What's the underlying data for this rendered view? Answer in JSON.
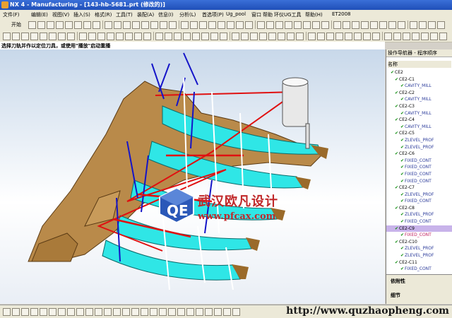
{
  "window": {
    "title": "NX 4 - Manufacturing - [143-hb-5681.prt (修改的)]"
  },
  "menu": [
    "文件(F)",
    "编辑(E)",
    "视图(V)",
    "插入(S)",
    "格式(R)",
    "工具(T)",
    "装配(A)",
    "信息(I)",
    "分析(L)",
    "首选项(P)",
    "Ug_pool",
    "窗口",
    "帮助",
    "环仪UG工具",
    "帮助(H)",
    "ET2008"
  ],
  "toolbar": {
    "start_label": "开始"
  },
  "cue_line": "选择刀轨并作以定位刀具，或使用\"播放\"启动重播",
  "navigator": {
    "title": "操作导航器 - 程序顺序",
    "column_name": "名称",
    "items": [
      {
        "label": "CE2",
        "kind": "group"
      },
      {
        "label": "CE2-C1",
        "kind": "group"
      },
      {
        "label": "CAVITY_MILL",
        "kind": "op"
      },
      {
        "label": "CE2-C2",
        "kind": "group"
      },
      {
        "label": "CAVITY_MILL",
        "kind": "op"
      },
      {
        "label": "CE2-C3",
        "kind": "group"
      },
      {
        "label": "CAVITY_MILL",
        "kind": "op"
      },
      {
        "label": "CE2-C4",
        "kind": "group"
      },
      {
        "label": "CAVITY_MILL",
        "kind": "op"
      },
      {
        "label": "CE2-C5",
        "kind": "group"
      },
      {
        "label": "ZLEVEL_PROF",
        "kind": "op"
      },
      {
        "label": "ZLEVEL_PROF",
        "kind": "op"
      },
      {
        "label": "CE2-C6",
        "kind": "group"
      },
      {
        "label": "FIXED_CONT",
        "kind": "op"
      },
      {
        "label": "FIXED_CONT",
        "kind": "op"
      },
      {
        "label": "FIXED_CONT",
        "kind": "op"
      },
      {
        "label": "FIXED_CONT",
        "kind": "op"
      },
      {
        "label": "CE2-C7",
        "kind": "group"
      },
      {
        "label": "ZLEVEL_PROF",
        "kind": "op"
      },
      {
        "label": "FIXED_CONT",
        "kind": "op"
      },
      {
        "label": "CE2-C8",
        "kind": "group"
      },
      {
        "label": "ZLEVEL_PROF",
        "kind": "op"
      },
      {
        "label": "FIXED_CONT",
        "kind": "op"
      },
      {
        "label": "CE2-C9",
        "kind": "group",
        "selected": true
      },
      {
        "label": "FIXED_CONT",
        "kind": "op",
        "pink": true
      },
      {
        "label": "CE2-C10",
        "kind": "group"
      },
      {
        "label": "ZLEVEL_PROF",
        "kind": "op"
      },
      {
        "label": "ZLEVEL_PROF",
        "kind": "op"
      },
      {
        "label": "CE2-C11",
        "kind": "group"
      },
      {
        "label": "FIXED_CONT",
        "kind": "op"
      }
    ],
    "dependency_title": "依附性",
    "details_title": "细节"
  },
  "watermark": {
    "logo_text": "QE",
    "cn": "武汉欧凡设计",
    "url": "www.pfcax.com"
  },
  "bottom_url": "http://www.quzhaopheng.com"
}
